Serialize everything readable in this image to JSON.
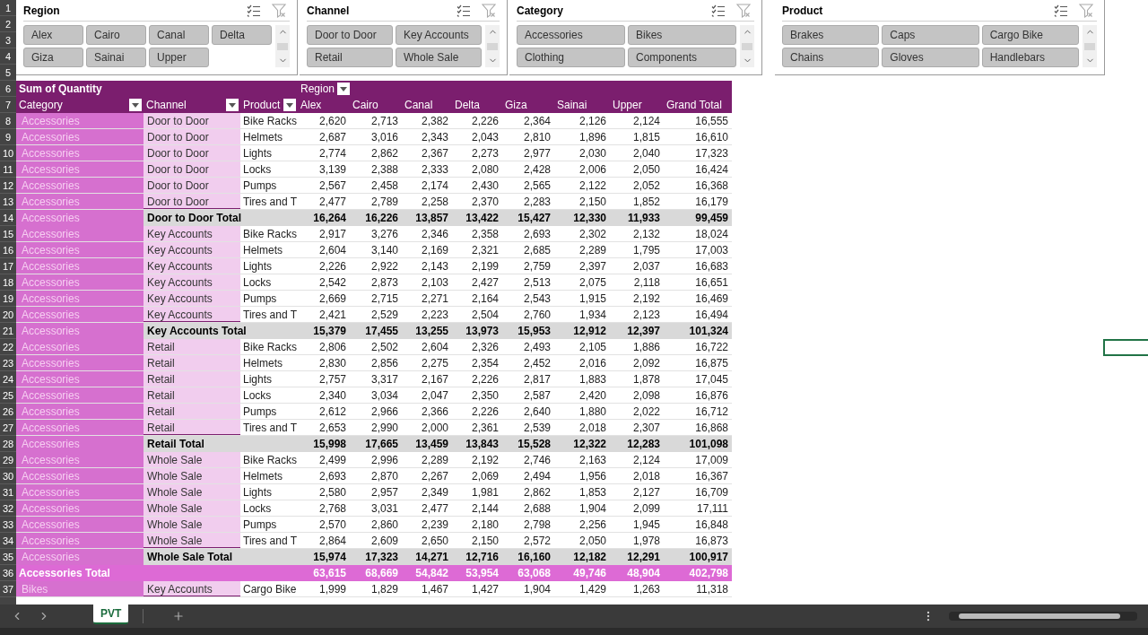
{
  "row_numbers": [
    "1",
    "2",
    "3",
    "4",
    "5",
    "6",
    "7",
    "8",
    "9",
    "10",
    "11",
    "12",
    "13",
    "14",
    "15",
    "16",
    "17",
    "18",
    "19",
    "20",
    "21",
    "22",
    "23",
    "24",
    "25",
    "26",
    "27",
    "28",
    "29",
    "30",
    "31",
    "32",
    "33",
    "34",
    "35",
    "36",
    "37"
  ],
  "slicers": [
    {
      "title": "Region",
      "items": [
        "Alex",
        "Cairo",
        "Canal",
        "Delta",
        "Giza",
        "Sainai",
        "Upper"
      ]
    },
    {
      "title": "Channel",
      "items": [
        "Door to Door",
        "Key Accounts",
        "Retail",
        "Whole Sale"
      ]
    },
    {
      "title": "Category",
      "items": [
        "Accessories",
        "Bikes",
        "Clothing",
        "Components"
      ]
    },
    {
      "title": "Product",
      "items": [
        "Brakes",
        "Caps",
        "Cargo Bike",
        "Chains",
        "Gloves",
        "Handlebars"
      ]
    }
  ],
  "pivot": {
    "value_label": "Sum of Quantity",
    "column_field": "Region",
    "row_fields": [
      "Category",
      "Channel",
      "Product"
    ],
    "columns": [
      "Alex",
      "Cairo",
      "Canal",
      "Delta",
      "Giza",
      "Sainai",
      "Upper",
      "Grand Total"
    ],
    "rows": [
      {
        "kind": "item",
        "category": "Accessories",
        "channel": "Door to Door",
        "product": "Bike Racks",
        "values": [
          "2,620",
          "2,713",
          "2,382",
          "2,226",
          "2,364",
          "2,126",
          "2,124",
          "16,555"
        ]
      },
      {
        "kind": "item",
        "category": "Accessories",
        "channel": "Door to Door",
        "product": "Helmets",
        "values": [
          "2,687",
          "3,016",
          "2,343",
          "2,043",
          "2,810",
          "1,896",
          "1,815",
          "16,610"
        ]
      },
      {
        "kind": "item",
        "category": "Accessories",
        "channel": "Door to Door",
        "product": "Lights",
        "values": [
          "2,774",
          "2,862",
          "2,367",
          "2,273",
          "2,977",
          "2,030",
          "2,040",
          "17,323"
        ]
      },
      {
        "kind": "item",
        "category": "Accessories",
        "channel": "Door to Door",
        "product": "Locks",
        "values": [
          "3,139",
          "2,388",
          "2,333",
          "2,080",
          "2,428",
          "2,006",
          "2,050",
          "16,424"
        ]
      },
      {
        "kind": "item",
        "category": "Accessories",
        "channel": "Door to Door",
        "product": "Pumps",
        "values": [
          "2,567",
          "2,458",
          "2,174",
          "2,430",
          "2,565",
          "2,122",
          "2,052",
          "16,368"
        ]
      },
      {
        "kind": "item",
        "category": "Accessories",
        "channel": "Door to Door",
        "product": "Tires and T",
        "values": [
          "2,477",
          "2,789",
          "2,258",
          "2,370",
          "2,283",
          "2,150",
          "1,852",
          "16,179"
        ]
      },
      {
        "kind": "subtotal",
        "category": "Accessories",
        "label": "Door to Door Total",
        "values": [
          "16,264",
          "16,226",
          "13,857",
          "13,422",
          "15,427",
          "12,330",
          "11,933",
          "99,459"
        ]
      },
      {
        "kind": "item",
        "category": "Accessories",
        "channel": "Key Accounts",
        "product": "Bike Racks",
        "values": [
          "2,917",
          "3,276",
          "2,346",
          "2,358",
          "2,693",
          "2,302",
          "2,132",
          "18,024"
        ]
      },
      {
        "kind": "item",
        "category": "Accessories",
        "channel": "Key Accounts",
        "product": "Helmets",
        "values": [
          "2,604",
          "3,140",
          "2,169",
          "2,321",
          "2,685",
          "2,289",
          "1,795",
          "17,003"
        ]
      },
      {
        "kind": "item",
        "category": "Accessories",
        "channel": "Key Accounts",
        "product": "Lights",
        "values": [
          "2,226",
          "2,922",
          "2,143",
          "2,199",
          "2,759",
          "2,397",
          "2,037",
          "16,683"
        ]
      },
      {
        "kind": "item",
        "category": "Accessories",
        "channel": "Key Accounts",
        "product": "Locks",
        "values": [
          "2,542",
          "2,873",
          "2,103",
          "2,427",
          "2,513",
          "2,075",
          "2,118",
          "16,651"
        ]
      },
      {
        "kind": "item",
        "category": "Accessories",
        "channel": "Key Accounts",
        "product": "Pumps",
        "values": [
          "2,669",
          "2,715",
          "2,271",
          "2,164",
          "2,543",
          "1,915",
          "2,192",
          "16,469"
        ]
      },
      {
        "kind": "item",
        "category": "Accessories",
        "channel": "Key Accounts",
        "product": "Tires and T",
        "values": [
          "2,421",
          "2,529",
          "2,223",
          "2,504",
          "2,760",
          "1,934",
          "2,123",
          "16,494"
        ]
      },
      {
        "kind": "subtotal",
        "category": "Accessories",
        "label": "Key Accounts Total",
        "values": [
          "15,379",
          "17,455",
          "13,255",
          "13,973",
          "15,953",
          "12,912",
          "12,397",
          "101,324"
        ]
      },
      {
        "kind": "item",
        "category": "Accessories",
        "channel": "Retail",
        "product": "Bike Racks",
        "values": [
          "2,806",
          "2,502",
          "2,604",
          "2,326",
          "2,493",
          "2,105",
          "1,886",
          "16,722"
        ]
      },
      {
        "kind": "item",
        "category": "Accessories",
        "channel": "Retail",
        "product": "Helmets",
        "values": [
          "2,830",
          "2,856",
          "2,275",
          "2,354",
          "2,452",
          "2,016",
          "2,092",
          "16,875"
        ]
      },
      {
        "kind": "item",
        "category": "Accessories",
        "channel": "Retail",
        "product": "Lights",
        "values": [
          "2,757",
          "3,317",
          "2,167",
          "2,226",
          "2,817",
          "1,883",
          "1,878",
          "17,045"
        ]
      },
      {
        "kind": "item",
        "category": "Accessories",
        "channel": "Retail",
        "product": "Locks",
        "values": [
          "2,340",
          "3,034",
          "2,047",
          "2,350",
          "2,587",
          "2,420",
          "2,098",
          "16,876"
        ]
      },
      {
        "kind": "item",
        "category": "Accessories",
        "channel": "Retail",
        "product": "Pumps",
        "values": [
          "2,612",
          "2,966",
          "2,366",
          "2,226",
          "2,640",
          "1,880",
          "2,022",
          "16,712"
        ]
      },
      {
        "kind": "item",
        "category": "Accessories",
        "channel": "Retail",
        "product": "Tires and T",
        "values": [
          "2,653",
          "2,990",
          "2,000",
          "2,361",
          "2,539",
          "2,018",
          "2,307",
          "16,868"
        ]
      },
      {
        "kind": "subtotal",
        "category": "Accessories",
        "label": "Retail Total",
        "values": [
          "15,998",
          "17,665",
          "13,459",
          "13,843",
          "15,528",
          "12,322",
          "12,283",
          "101,098"
        ]
      },
      {
        "kind": "item",
        "category": "Accessories",
        "channel": "Whole Sale",
        "product": "Bike Racks",
        "values": [
          "2,499",
          "2,996",
          "2,289",
          "2,192",
          "2,746",
          "2,163",
          "2,124",
          "17,009"
        ]
      },
      {
        "kind": "item",
        "category": "Accessories",
        "channel": "Whole Sale",
        "product": "Helmets",
        "values": [
          "2,693",
          "2,870",
          "2,267",
          "2,069",
          "2,494",
          "1,956",
          "2,018",
          "16,367"
        ]
      },
      {
        "kind": "item",
        "category": "Accessories",
        "channel": "Whole Sale",
        "product": "Lights",
        "values": [
          "2,580",
          "2,957",
          "2,349",
          "1,981",
          "2,862",
          "1,853",
          "2,127",
          "16,709"
        ]
      },
      {
        "kind": "item",
        "category": "Accessories",
        "channel": "Whole Sale",
        "product": "Locks",
        "values": [
          "2,768",
          "3,031",
          "2,477",
          "2,144",
          "2,688",
          "1,904",
          "2,099",
          "17,111"
        ]
      },
      {
        "kind": "item",
        "category": "Accessories",
        "channel": "Whole Sale",
        "product": "Pumps",
        "values": [
          "2,570",
          "2,860",
          "2,239",
          "2,180",
          "2,798",
          "2,256",
          "1,945",
          "16,848"
        ]
      },
      {
        "kind": "item",
        "category": "Accessories",
        "channel": "Whole Sale",
        "product": "Tires and T",
        "values": [
          "2,864",
          "2,609",
          "2,650",
          "2,150",
          "2,572",
          "2,050",
          "1,978",
          "16,873"
        ]
      },
      {
        "kind": "subtotal",
        "category": "Accessories",
        "label": "Whole Sale Total",
        "values": [
          "15,974",
          "17,323",
          "14,271",
          "12,716",
          "16,160",
          "12,182",
          "12,291",
          "100,917"
        ]
      },
      {
        "kind": "total",
        "category": "Accessories Total",
        "values": [
          "63,615",
          "68,669",
          "54,842",
          "53,954",
          "63,068",
          "49,746",
          "48,904",
          "402,798"
        ]
      },
      {
        "kind": "item",
        "category": "Bikes",
        "channel": "Key Accounts",
        "product": "Cargo Bike",
        "values": [
          "1,999",
          "1,829",
          "1,467",
          "1,427",
          "1,904",
          "1,429",
          "1,263",
          "11,318"
        ]
      }
    ]
  },
  "sheet_tabs": [
    {
      "label": "PVT",
      "selected": true
    }
  ]
}
